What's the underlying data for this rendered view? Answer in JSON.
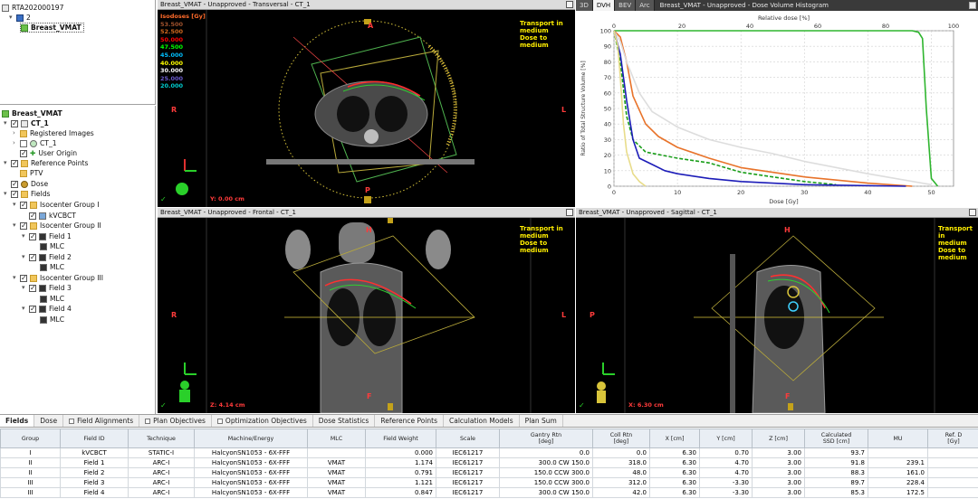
{
  "top_tree": {
    "patient_id": "RTA202000197",
    "course": "2",
    "plan": "Breast_VMAT"
  },
  "tree": {
    "plan": "Breast_VMAT",
    "ct": "CT_1",
    "registered_images": "Registered Images",
    "ct_sub": "CT_1",
    "user_origin": "User Origin",
    "reference_points": "Reference Points",
    "ptv": "PTV",
    "dose": "Dose",
    "fields": "Fields",
    "iso1": "Isocenter Group I",
    "kvcbct": "kVCBCT",
    "iso2": "Isocenter Group II",
    "field1": "Field 1",
    "mlc1": "MLC",
    "field2": "Field 2",
    "mlc2": "MLC",
    "iso3": "Isocenter Group III",
    "field3": "Field 3",
    "mlc3": "MLC",
    "field4": "Field 4",
    "mlc4": "MLC"
  },
  "views": {
    "transversal_title": "Breast_VMAT - Unapproved - Transversal - CT_1",
    "frontal_title": "Breast_VMAT - Unapproved - Frontal - CT_1",
    "sagittal_title": "Breast_VMAT - Unapproved - Sagittal - CT_1",
    "transport_1": "Transport in",
    "transport_2": "medium",
    "transport_3": "Dose to medium",
    "transversal_coord": "Y: 0.00 cm",
    "frontal_coord": "Z: 4.14 cm",
    "sagittal_coord": "X: 6.30 cm",
    "orient_r": "R",
    "orient_l": "L",
    "orient_a": "A",
    "orient_p": "P",
    "orient_h": "H",
    "orient_f": "F"
  },
  "isodoses": {
    "header": "Isodoses [Gy]",
    "levels": [
      {
        "label": "53.500",
        "color": "#a0522d"
      },
      {
        "label": "52.500",
        "color": "#d2691e"
      },
      {
        "label": "50.000",
        "color": "#ff0000"
      },
      {
        "label": "47.500",
        "color": "#00ff00"
      },
      {
        "label": "45.000",
        "color": "#00bfff"
      },
      {
        "label": "40.000",
        "color": "#ffff00"
      },
      {
        "label": "30.000",
        "color": "#ffffff"
      },
      {
        "label": "25.000",
        "color": "#6a5acd"
      },
      {
        "label": "20.000",
        "color": "#00ced1"
      }
    ]
  },
  "dvh": {
    "tabs": [
      "3D",
      "DVH",
      "BEV",
      "Arc"
    ],
    "active_tab": "DVH",
    "title": "Breast_VMAT - Unapproved - Dose Volume Histogram"
  },
  "chart_data": {
    "type": "line",
    "title": "",
    "xlabel": "Dose [Gy]",
    "x2label": "Relative dose [%]",
    "ylabel": "Ratio of Total Structure Volume [%]",
    "xlim": [
      0,
      53.5
    ],
    "ylim": [
      0,
      100
    ],
    "x_ticks": [
      0,
      10,
      20,
      30,
      40,
      50
    ],
    "x2_ticks": [
      0,
      20,
      40,
      60,
      80,
      100
    ],
    "y_ticks": [
      0,
      10,
      20,
      30,
      40,
      50,
      60,
      70,
      80,
      90,
      100
    ],
    "grid": true,
    "series": [
      {
        "color": "#2fb52f",
        "style": "solid",
        "x": [
          0,
          47,
          48,
          48.6,
          49.2,
          50,
          51
        ],
        "y": [
          100,
          100,
          99,
          95,
          50,
          5,
          0
        ]
      },
      {
        "color": "#e8732a",
        "style": "solid",
        "x": [
          0,
          1,
          2,
          3,
          5,
          7,
          10,
          15,
          20,
          30,
          40,
          47
        ],
        "y": [
          100,
          96,
          80,
          58,
          40,
          32,
          25,
          18,
          12,
          6,
          2,
          0
        ]
      },
      {
        "color": "#dddddd",
        "style": "solid",
        "x": [
          0,
          1,
          2,
          4,
          6,
          10,
          15,
          20,
          25,
          30,
          40,
          50
        ],
        "y": [
          100,
          93,
          80,
          60,
          48,
          38,
          30,
          25,
          21,
          16,
          8,
          1
        ]
      },
      {
        "color": "#1a9e1a",
        "style": "dashed",
        "x": [
          0,
          1,
          2,
          3,
          5,
          10,
          15,
          20,
          25,
          30,
          35
        ],
        "y": [
          100,
          80,
          45,
          30,
          22,
          18,
          15,
          9,
          6,
          3,
          1
        ]
      },
      {
        "color": "#1c1cb8",
        "style": "solid",
        "x": [
          0,
          1,
          2,
          3,
          4,
          6,
          8,
          10,
          15,
          20,
          30,
          46
        ],
        "y": [
          100,
          85,
          55,
          30,
          18,
          14,
          10,
          8,
          5,
          3,
          1,
          0
        ]
      },
      {
        "color": "#e8dc8a",
        "style": "solid",
        "x": [
          0,
          0.6,
          1,
          1.5,
          2,
          3,
          4,
          5
        ],
        "y": [
          100,
          90,
          70,
          40,
          22,
          8,
          3,
          0
        ]
      }
    ]
  },
  "bottom_tabs": [
    {
      "label": "Fields",
      "active": true,
      "checkbox": false
    },
    {
      "label": "Dose",
      "active": false,
      "checkbox": false
    },
    {
      "label": "Field Alignments",
      "active": false,
      "checkbox": true
    },
    {
      "label": "Plan Objectives",
      "active": false,
      "checkbox": true
    },
    {
      "label": "Optimization Objectives",
      "active": false,
      "checkbox": true
    },
    {
      "label": "Dose Statistics",
      "active": false,
      "checkbox": false
    },
    {
      "label": "Reference Points",
      "active": false,
      "checkbox": false
    },
    {
      "label": "Calculation Models",
      "active": false,
      "checkbox": false
    },
    {
      "label": "Plan Sum",
      "active": false,
      "checkbox": false
    }
  ],
  "table": {
    "headers": [
      "Group",
      "Field ID",
      "Technique",
      "Machine/Energy",
      "MLC",
      "Field Weight",
      "Scale",
      "Gantry Rtn\n[deg]",
      "Coll Rtn\n[deg]",
      "X [cm]",
      "Y [cm]",
      "Z [cm]",
      "Calculated\nSSD [cm]",
      "MU",
      "Ref. D\n[Gy]"
    ],
    "rows": [
      [
        "I",
        "kVCBCT",
        "STATIC-I",
        "HalcyonSN1053 - 6X-FFF",
        "",
        "0.000",
        "IEC61217",
        "0.0",
        "0.0",
        "6.30",
        "0.70",
        "3.00",
        "93.7",
        "",
        ""
      ],
      [
        "II",
        "Field 1",
        "ARC-I",
        "HalcyonSN1053 - 6X-FFF",
        "VMAT",
        "1.174",
        "IEC61217",
        "300.0 CW 150.0",
        "318.0",
        "6.30",
        "4.70",
        "3.00",
        "91.8",
        "239.1",
        ""
      ],
      [
        "II",
        "Field 2",
        "ARC-I",
        "HalcyonSN1053 - 6X-FFF",
        "VMAT",
        "0.791",
        "IEC61217",
        "150.0 CCW 300.0",
        "48.0",
        "6.30",
        "4.70",
        "3.00",
        "88.3",
        "161.0",
        ""
      ],
      [
        "III",
        "Field 3",
        "ARC-I",
        "HalcyonSN1053 - 6X-FFF",
        "VMAT",
        "1.121",
        "IEC61217",
        "150.0 CCW 300.0",
        "312.0",
        "6.30",
        "-3.30",
        "3.00",
        "89.7",
        "228.4",
        ""
      ],
      [
        "III",
        "Field 4",
        "ARC-I",
        "HalcyonSN1053 - 6X-FFF",
        "VMAT",
        "0.847",
        "IEC61217",
        "300.0 CW 150.0",
        "42.0",
        "6.30",
        "-3.30",
        "3.00",
        "85.3",
        "172.5",
        ""
      ]
    ]
  }
}
